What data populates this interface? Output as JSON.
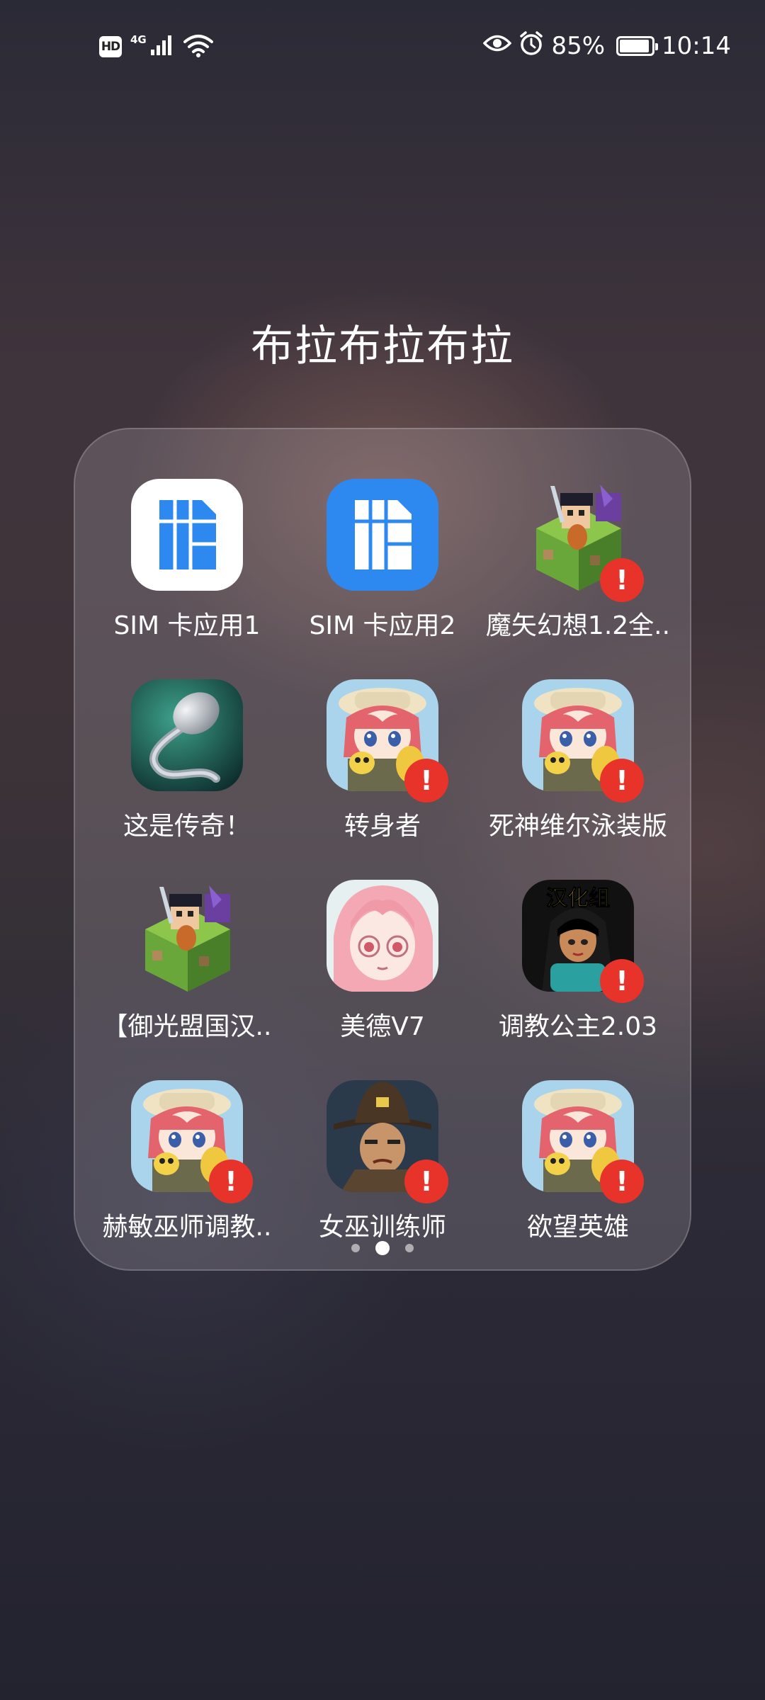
{
  "status_bar": {
    "hd": "HD",
    "network": "4G",
    "battery_percent": "85%",
    "battery_level": 0.85,
    "time": "10:14",
    "icons": [
      "hd-icon",
      "signal-icon",
      "wifi-icon",
      "eye-icon",
      "alarm-icon",
      "battery-icon"
    ]
  },
  "folder": {
    "title": "布拉布拉布拉",
    "pages": 3,
    "current_page": 2,
    "apps": [
      {
        "label": "SIM 卡应用1",
        "icon": "sim-card-icon",
        "alert": false
      },
      {
        "label": "SIM 卡应用2",
        "icon": "sim-card-icon",
        "alert": false
      },
      {
        "label": "魔矢幻想1.2全..",
        "icon": "pixel-cube-game-icon",
        "alert": true
      },
      {
        "label": "这是传奇！",
        "icon": "sperm-game-icon",
        "alert": false
      },
      {
        "label": "转身者",
        "icon": "anime-girl-icon",
        "alert": true
      },
      {
        "label": "死神维尔泳装版",
        "icon": "anime-girl-icon",
        "alert": true
      },
      {
        "label": "【御光盟国汉..",
        "icon": "pixel-cube-game-icon",
        "alert": false
      },
      {
        "label": "美德V7",
        "icon": "pink-hair-girl-icon",
        "alert": false
      },
      {
        "label": "调教公主2.03",
        "icon": "princess-comic-icon",
        "alert": true
      },
      {
        "label": "赫敏巫师调教..",
        "icon": "anime-girl-icon",
        "alert": true
      },
      {
        "label": "女巫训练师",
        "icon": "wizard-man-icon",
        "alert": true
      },
      {
        "label": "欲望英雄",
        "icon": "anime-girl-icon",
        "alert": true
      }
    ],
    "alert_glyph": "!",
    "comic_banner_text": "汉化组"
  },
  "colors": {
    "alert_red": "#e8332a",
    "sim_blue": "#2d88f0"
  }
}
